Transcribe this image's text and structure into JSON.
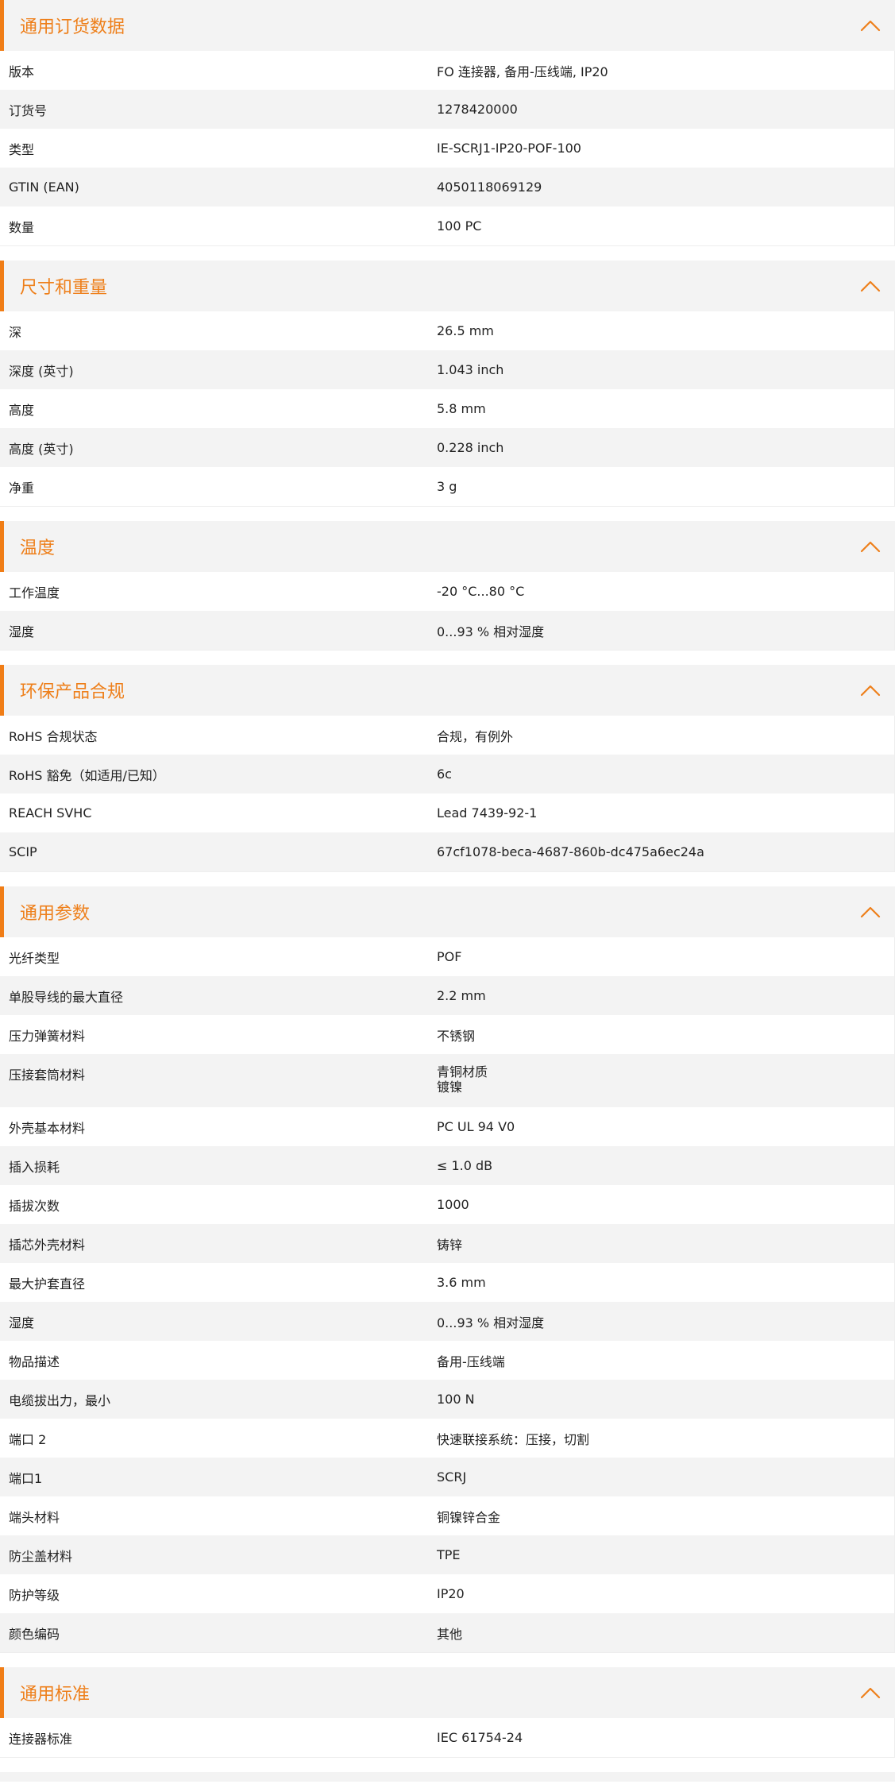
{
  "sections": [
    {
      "title": "通用订货数据",
      "rows": [
        {
          "label": "版本",
          "value": "FO 连接器, 备用-压线端, IP20"
        },
        {
          "label": "订货号",
          "value": "1278420000"
        },
        {
          "label": "类型",
          "value": "IE-SCRJ1-IP20-POF-100"
        },
        {
          "label": "GTIN (EAN)",
          "value": "4050118069129"
        },
        {
          "label": "数量",
          "value": "100  PC"
        }
      ]
    },
    {
      "title": "尺寸和重量",
      "rows": [
        {
          "label": "深",
          "value": "26.5  mm"
        },
        {
          "label": "深度 (英寸)",
          "value": "1.043  inch"
        },
        {
          "label": "高度",
          "value": "5.8  mm"
        },
        {
          "label": "高度 (英寸)",
          "value": "0.228  inch"
        },
        {
          "label": "净重",
          "value": "3  g"
        }
      ]
    },
    {
      "title": "温度",
      "rows": [
        {
          "label": "工作温度",
          "value": "-20 °C...80 °C"
        },
        {
          "label": "湿度",
          "value": "0...93 % 相对湿度"
        }
      ]
    },
    {
      "title": "环保产品合规",
      "rows": [
        {
          "label": "RoHS 合规状态",
          "value": "合规，有例外"
        },
        {
          "label": "RoHS 豁免（如适用/已知）",
          "value": "6c"
        },
        {
          "label": "REACH SVHC",
          "value": "Lead 7439-92-1"
        },
        {
          "label": "SCIP",
          "value": "67cf1078-beca-4687-860b-dc475a6ec24a"
        }
      ]
    },
    {
      "title": "通用参数",
      "rows": [
        {
          "label": "光纤类型",
          "value": "POF"
        },
        {
          "label": "单股导线的最大直径",
          "value": "2.2  mm"
        },
        {
          "label": "压力弹簧材料",
          "value": "不锈钢"
        },
        {
          "label": "压接套筒材料",
          "value": "青铜材质",
          "value2": "镀镍"
        },
        {
          "label": "外壳基本材料",
          "value": "PC UL 94 V0"
        },
        {
          "label": "插入损耗",
          "value": "≤ 1.0 dB"
        },
        {
          "label": "插拔次数",
          "value": "1000"
        },
        {
          "label": "插芯外壳材料",
          "value": "铸锌"
        },
        {
          "label": "最大护套直径",
          "value": "3.6  mm"
        },
        {
          "label": "湿度",
          "value": "0...93 % 相对湿度"
        },
        {
          "label": "物品描述",
          "value": "备用-压线端"
        },
        {
          "label": "电缆拔出力，最小",
          "value": "100  N"
        },
        {
          "label": "端口 2",
          "value": "快速联接系统：压接，切割"
        },
        {
          "label": "端口1",
          "value": "SCRJ"
        },
        {
          "label": "端头材料",
          "value": "铜镍锌合金"
        },
        {
          "label": "防尘盖材料",
          "value": "TPE"
        },
        {
          "label": "防护等级",
          "value": "IP20"
        },
        {
          "label": "颜色编码",
          "value": "其他"
        }
      ]
    },
    {
      "title": "通用标准",
      "rows": [
        {
          "label": "连接器标准",
          "value": "IEC 61754-24"
        }
      ]
    }
  ],
  "icons": {
    "collapse": "chevron-up-icon"
  },
  "colors": {
    "accent": "#ee7f1a",
    "accent_bar": "#f07d16",
    "row_alt": "#f3f3f3"
  }
}
